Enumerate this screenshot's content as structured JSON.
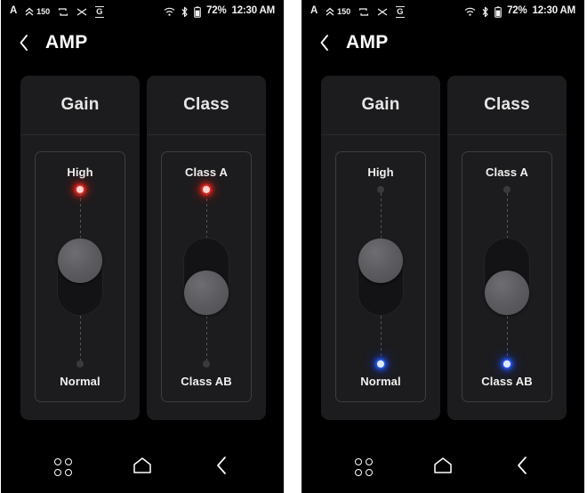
{
  "status_bar": {
    "icons_left": [
      {
        "name": "font-size-icon",
        "glyph": "A"
      },
      {
        "name": "volume-level-icon",
        "glyph": "150"
      },
      {
        "name": "repeat-icon",
        "glyph": "repeat"
      },
      {
        "name": "shuffle-icon",
        "glyph": "shuffle"
      },
      {
        "name": "equalizer-g-icon",
        "glyph": "G"
      }
    ],
    "volume_level": "150",
    "eq_badge": "G",
    "font_glyph": "A",
    "wifi": "wifi-icon",
    "bluetooth": "bluetooth-icon",
    "battery_icon": "battery-icon",
    "battery_percent": "72%",
    "time": "12:30 AM"
  },
  "title_bar": {
    "back_label": "back-chevron",
    "title": "AMP"
  },
  "nav_bar": {
    "recents_label": "recents-icon",
    "home_label": "home-icon",
    "back_label": "back-icon"
  },
  "colors": {
    "background": "#000000",
    "card": "#1c1c1e",
    "panel_border": "#3d3d3f",
    "knob": "#5c5c60",
    "track": "#131315",
    "led_off": "#3a3a3c",
    "led_red": "#ff3b30",
    "led_blue": "#2e6dff",
    "text_primary": "#ffffff"
  },
  "screens": [
    {
      "id": "screen-left",
      "cards": [
        {
          "name": "gain",
          "title": "Gain",
          "top_label": "High",
          "bottom_label": "Normal",
          "top_led": "red",
          "bottom_led": "off",
          "knob_position": "top",
          "selected": "High"
        },
        {
          "name": "class",
          "title": "Class",
          "top_label": "Class A",
          "bottom_label": "Class AB",
          "top_led": "red",
          "bottom_led": "off",
          "knob_position": "bottom",
          "selected": "Class A"
        }
      ]
    },
    {
      "id": "screen-right",
      "cards": [
        {
          "name": "gain",
          "title": "Gain",
          "top_label": "High",
          "bottom_label": "Normal",
          "top_led": "off",
          "bottom_led": "blue",
          "knob_position": "top",
          "selected": "Normal"
        },
        {
          "name": "class",
          "title": "Class",
          "top_label": "Class A",
          "bottom_label": "Class AB",
          "top_led": "off",
          "bottom_led": "blue",
          "knob_position": "bottom",
          "selected": "Class AB"
        }
      ]
    }
  ]
}
